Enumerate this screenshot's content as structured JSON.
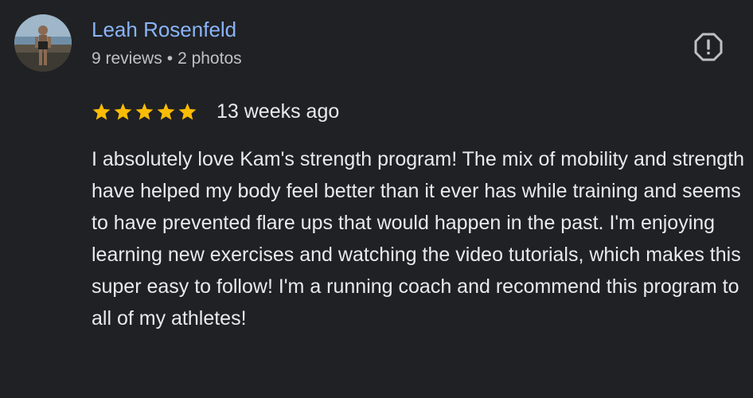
{
  "author": {
    "name": "Leah Rosenfeld",
    "reviews": "9 reviews",
    "separator": "•",
    "photos": "2 photos"
  },
  "review": {
    "rating": 5,
    "max_rating": 5,
    "date": "13 weeks ago",
    "text": "I absolutely love Kam's strength program! The mix of mobility and strength have helped my body feel better than it ever has while training and seems to have prevented flare ups that would happen in the past. I'm enjoying learning new exercises and watching the video tutorials, which makes this super easy to follow! I'm a running coach and recommend this program to all of my athletes!"
  },
  "icons": {
    "report": "report-icon",
    "star": "star-icon"
  },
  "colors": {
    "background": "#202124",
    "author_name": "#8ab4f8",
    "meta_text": "#bdc1c6",
    "body_text": "#e8eaed",
    "star": "#fbbc04",
    "icon": "#bdc1c6"
  }
}
